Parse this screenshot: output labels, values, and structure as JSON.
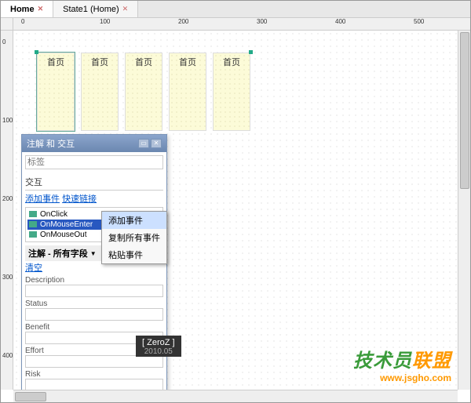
{
  "tabs": [
    {
      "label": "Home",
      "active": true
    },
    {
      "label": "State1 (Home)",
      "active": false
    }
  ],
  "ruler_h": [
    "0",
    "100",
    "200",
    "300",
    "400",
    "500"
  ],
  "ruler_v": [
    "0",
    "100",
    "200",
    "300",
    "400"
  ],
  "widgets": [
    "首页",
    "首页",
    "首页",
    "首页",
    "首页"
  ],
  "selected_widget_label": "首页",
  "panel": {
    "title": "注解 和 交互",
    "label_placeholder": "标签",
    "interaction_heading": "交互",
    "add_event_link": "添加事件",
    "quick_link": "快速链接",
    "events": [
      "OnClick",
      "OnMouseEnter",
      "OnMouseOut"
    ],
    "selected_event_index": 1,
    "annotation_heading": "注解 - 所有字段",
    "clear_link": "清空",
    "fields": [
      "Description",
      "Status",
      "Benefit",
      "Effort",
      "Risk"
    ]
  },
  "context_menu": {
    "items": [
      "添加事件",
      "复制所有事件",
      "粘贴事件"
    ],
    "hover_index": 0
  },
  "watermark": {
    "name": "[ ZeroZ ]",
    "date": "2010.05"
  },
  "logo": {
    "text_main": "技术员",
    "text_accent": "联盟",
    "url": "www.jsgho.com"
  }
}
